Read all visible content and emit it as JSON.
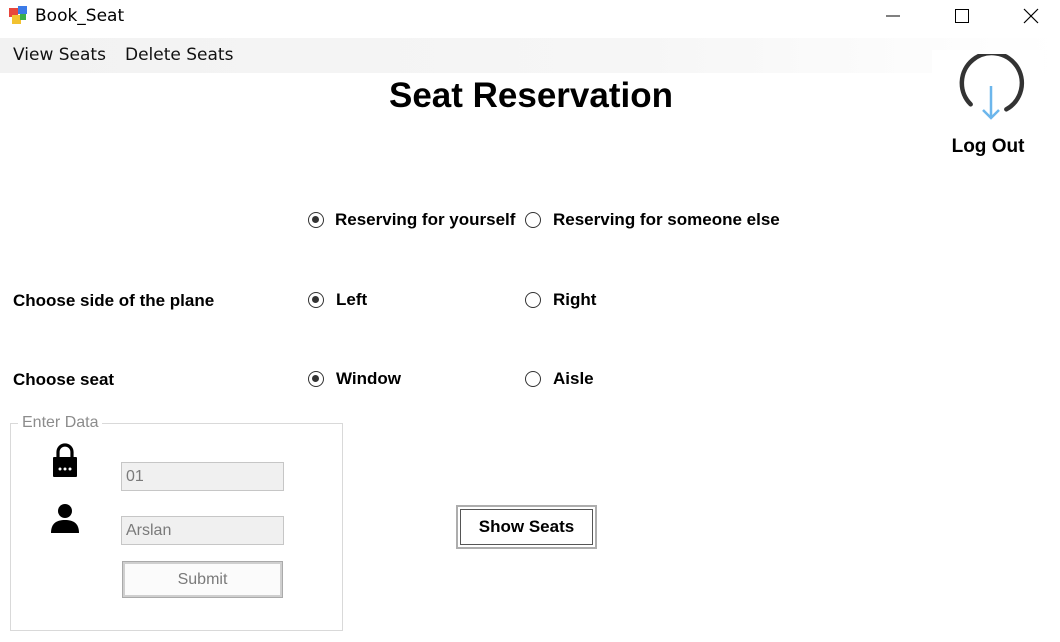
{
  "window": {
    "title": "Book_Seat"
  },
  "menu": {
    "items": [
      "View Seats",
      "Delete Seats"
    ]
  },
  "page": {
    "title": "Seat Reservation"
  },
  "logout": {
    "label": "Log Out",
    "icon": "logout-power-icon"
  },
  "reservation_for": {
    "options": [
      {
        "label": "Reserving for yourself",
        "checked": true
      },
      {
        "label": "Reserving for someone else",
        "checked": false
      }
    ]
  },
  "plane_side": {
    "label": "Choose side of the plane",
    "options": [
      {
        "label": "Left",
        "checked": true
      },
      {
        "label": "Right",
        "checked": false
      }
    ]
  },
  "seat": {
    "label": "Choose seat",
    "options": [
      {
        "label": "Window",
        "checked": true
      },
      {
        "label": "Aisle",
        "checked": false
      }
    ]
  },
  "enter_data": {
    "caption": "Enter Data",
    "id_value": "01",
    "name_value": "Arslan",
    "id_icon": "lock-icon",
    "name_icon": "user-icon",
    "submit_label": "Submit"
  },
  "actions": {
    "show_seats_label": "Show Seats"
  },
  "colors": {
    "accent_icon": "#6cb6ec",
    "disabled_text": "#7a7a7a"
  }
}
